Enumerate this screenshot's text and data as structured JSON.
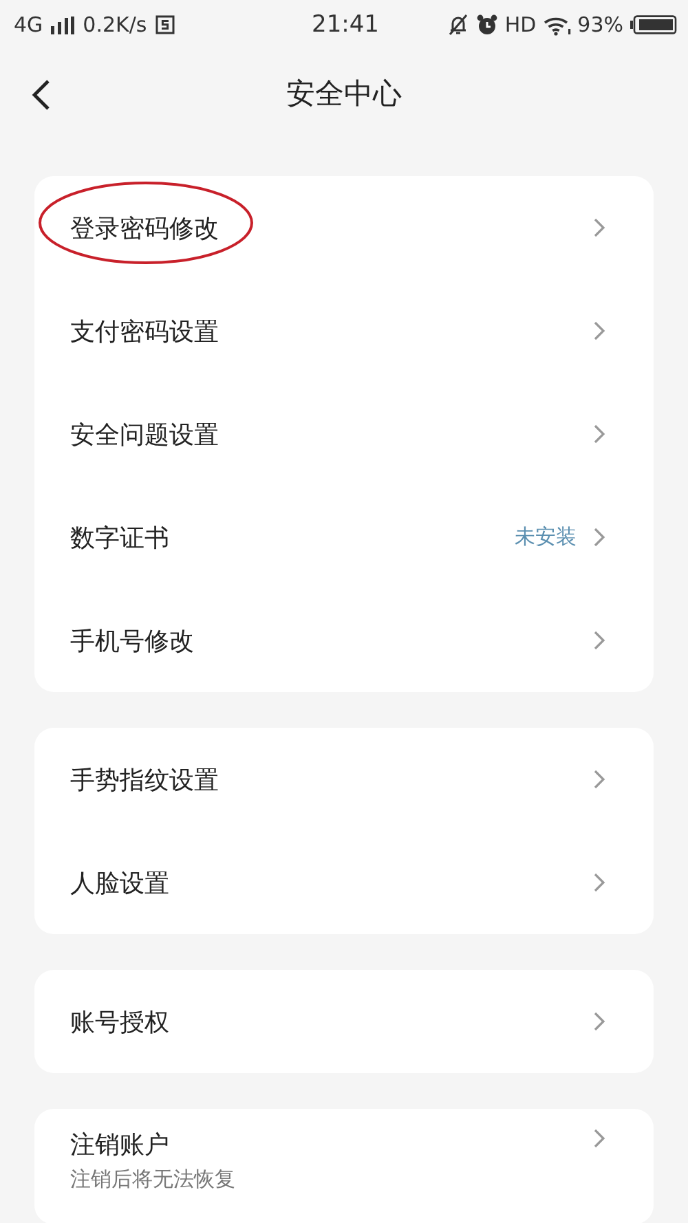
{
  "status_bar": {
    "network": "4G",
    "speed": "0.2K/s",
    "time": "21:41",
    "hd": "HD",
    "battery": "93%"
  },
  "header": {
    "title": "安全中心"
  },
  "groups": [
    {
      "items": [
        {
          "label": "登录密码修改",
          "circled": true
        },
        {
          "label": "支付密码设置",
          "circled": false
        },
        {
          "label": "安全问题设置",
          "circled": false
        },
        {
          "label": "数字证书",
          "value": "未安装",
          "circled": false
        },
        {
          "label": "手机号修改",
          "circled": false
        }
      ]
    },
    {
      "items": [
        {
          "label": "手势指纹设置",
          "circled": false
        },
        {
          "label": "人脸设置",
          "circled": false
        }
      ]
    },
    {
      "items": [
        {
          "label": "账号授权",
          "circled": false
        }
      ]
    },
    {
      "items": [
        {
          "label": "注销账户",
          "subtitle": "注销后将无法恢复",
          "circled": false
        }
      ]
    }
  ]
}
